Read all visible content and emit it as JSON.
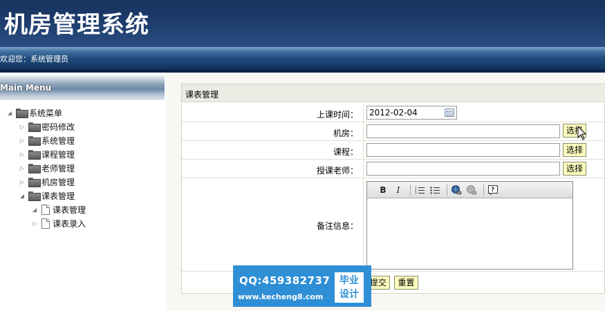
{
  "app": {
    "title": "机房管理系统"
  },
  "welcome": {
    "text": "欢迎您：系统管理员"
  },
  "sidebar": {
    "header": "Main Menu",
    "root": {
      "label": "系统菜单",
      "icon": "folder-icon"
    },
    "items": [
      {
        "label": "密码修改",
        "icon": "folder-icon"
      },
      {
        "label": "系统管理",
        "icon": "folder-icon"
      },
      {
        "label": "课程管理",
        "icon": "folder-icon"
      },
      {
        "label": "老师管理",
        "icon": "folder-icon"
      },
      {
        "label": "机房管理",
        "icon": "folder-icon"
      },
      {
        "label": "课表管理",
        "icon": "folder-icon",
        "expanded": true
      }
    ],
    "subitems": [
      {
        "label": "课表管理",
        "icon": "document-icon"
      },
      {
        "label": "课表录入",
        "icon": "document-icon"
      }
    ]
  },
  "form": {
    "title": "课表管理",
    "date_label": "上课时间：",
    "date_value": "2012-02-04",
    "room_label": "机房：",
    "room_value": "",
    "course_label": "课程：",
    "course_value": "",
    "teacher_label": "授课老师：",
    "teacher_value": "",
    "select_label": "选择",
    "notes_label": "备注信息：",
    "editor_tools": [
      "bold-icon",
      "italic-icon",
      "ordered-list-icon",
      "unordered-list-icon",
      "link-icon",
      "unlink-icon",
      "help-icon"
    ],
    "submit_label": "提交",
    "reset_label": "重置"
  },
  "watermark": {
    "qq": "QQ:459382737",
    "url": "www.kecheng8.com",
    "badge_line1": "毕业",
    "badge_line2": "设计"
  },
  "colors": {
    "header_bg": "#1d3c6c",
    "button_bg": "#ffffc0",
    "watermark_bg": "#2f8fd6"
  }
}
